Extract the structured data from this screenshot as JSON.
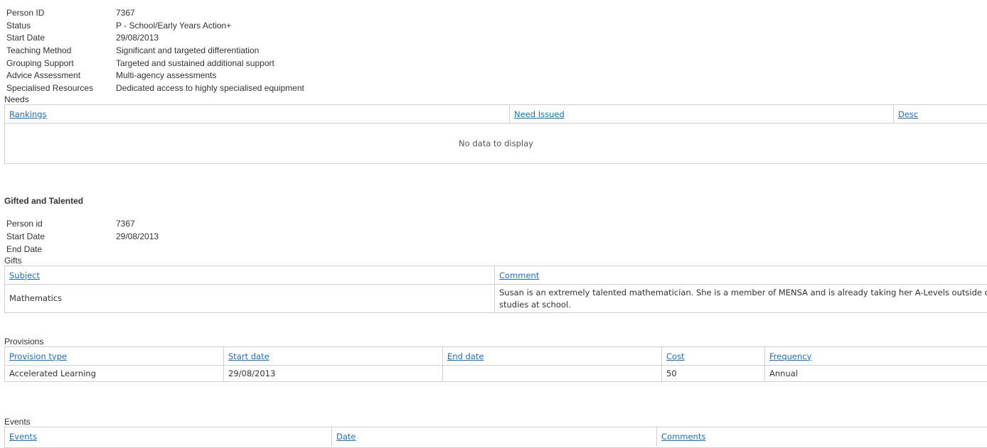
{
  "details": [
    {
      "label": "Person ID",
      "value": "7367"
    },
    {
      "label": "Status",
      "value": "P - School/Early Years Action+"
    },
    {
      "label": "Start Date",
      "value": "29/08/2013"
    },
    {
      "label": "Teaching Method",
      "value": "Significant and targeted differentiation"
    },
    {
      "label": "Grouping Support",
      "value": "Targeted and sustained additional support"
    },
    {
      "label": "Advice Assessment",
      "value": "Multi-agency assessments"
    },
    {
      "label": "Specialised Resources",
      "value": "Dedicated access to highly specialised equipment"
    }
  ],
  "needs": {
    "caption": "Needs",
    "columns": [
      "Rankings",
      "Need Issued",
      "Desc"
    ],
    "empty_text": "No data to display"
  },
  "gifted": {
    "heading": "Gifted and Talented",
    "details": [
      {
        "label": "Person id",
        "value": "7367"
      },
      {
        "label": "Start Date",
        "value": "29/08/2013"
      },
      {
        "label": "End Date",
        "value": ""
      }
    ]
  },
  "gifts": {
    "caption": "Gifts",
    "columns": [
      "Subject",
      "Comment"
    ],
    "rows": [
      {
        "subject": "Mathematics",
        "comment_line1": "Susan is an extremely talented mathematician. She is a member of MENSA and is already taking her A-Levels outside of her",
        "comment_line2": "studies at school."
      }
    ]
  },
  "provisions": {
    "caption": "Provisions",
    "columns": [
      "Provision type",
      "Start date",
      "End date",
      "Cost",
      "Frequency"
    ],
    "rows": [
      {
        "provision_type": "Accelerated Learning",
        "start_date": "29/08/2013",
        "end_date": "",
        "cost": "50",
        "frequency": "Annual"
      }
    ]
  },
  "events": {
    "caption": "Events",
    "columns": [
      "Events",
      "Date",
      "Comments"
    ]
  },
  "colors": {
    "link": "#1f6eb4",
    "border": "#cfcfcf",
    "text": "#333333"
  }
}
